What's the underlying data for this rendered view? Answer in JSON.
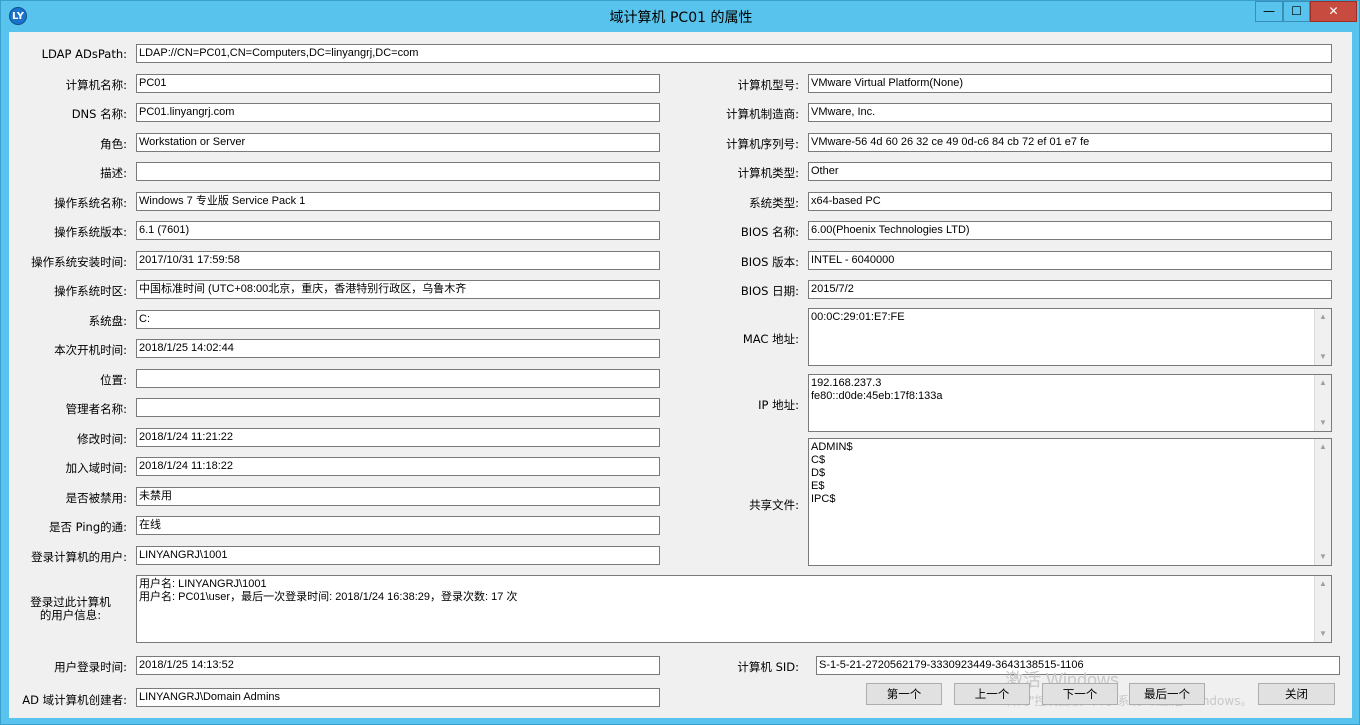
{
  "window": {
    "title": "域计算机 PC01 的属性",
    "icon_text": "LY",
    "minimize": "—",
    "maximize": "☐",
    "close": "✕"
  },
  "ldap": {
    "label": "LDAP ADsPath:",
    "value": "LDAP://CN=PC01,CN=Computers,DC=linyangrj,DC=com"
  },
  "left_fields": [
    {
      "label": "计算机名称:",
      "value": "PC01"
    },
    {
      "label": "DNS 名称:",
      "value": "PC01.linyangrj.com"
    },
    {
      "label": "角色:",
      "value": "Workstation or Server"
    },
    {
      "label": "描述:",
      "value": ""
    },
    {
      "label": "操作系统名称:",
      "value": "Windows 7 专业版 Service Pack 1"
    },
    {
      "label": "操作系统版本:",
      "value": "6.1 (7601)"
    },
    {
      "label": "操作系统安装时间:",
      "value": "2017/10/31 17:59:58"
    },
    {
      "label": "操作系统时区:",
      "value": "中国标准时间 (UTC+08:00北京，重庆，香港特别行政区，乌鲁木齐"
    },
    {
      "label": "系统盘:",
      "value": "C:"
    },
    {
      "label": "本次开机时间:",
      "value": "2018/1/25 14:02:44"
    },
    {
      "label": "位置:",
      "value": ""
    },
    {
      "label": "管理者名称:",
      "value": ""
    },
    {
      "label": "修改时间:",
      "value": "2018/1/24 11:21:22"
    },
    {
      "label": "加入域时间:",
      "value": "2018/1/24 11:18:22"
    },
    {
      "label": "是否被禁用:",
      "value": "未禁用"
    },
    {
      "label": "是否 Ping的通:",
      "value": "在线"
    },
    {
      "label": "登录计算机的用户:",
      "value": "LINYANGRJ\\1001"
    }
  ],
  "right_fields": [
    {
      "label": "计算机型号:",
      "value": "VMware Virtual Platform(None)"
    },
    {
      "label": "计算机制造商:",
      "value": "VMware, Inc."
    },
    {
      "label": "计算机序列号:",
      "value": "VMware-56 4d 60 26 32 ce 49 0d-c6 84 cb 72 ef 01 e7 fe"
    },
    {
      "label": "计算机类型:",
      "value": "Other"
    },
    {
      "label": "系统类型:",
      "value": "x64-based PC"
    },
    {
      "label": "BIOS 名称:",
      "value": "6.00(Phoenix Technologies LTD)"
    },
    {
      "label": "BIOS 版本:",
      "value": "INTEL  - 6040000"
    },
    {
      "label": "BIOS 日期:",
      "value": "2015/7/2"
    }
  ],
  "mac": {
    "label": "MAC 地址:",
    "lines": [
      "00:0C:29:01:E7:FE"
    ]
  },
  "ip": {
    "label": "IP 地址:",
    "lines": [
      "192.168.237.3",
      "fe80::d0de:45eb:17f8:133a"
    ]
  },
  "shares": {
    "label": "共享文件:",
    "lines": [
      "ADMIN$",
      "C$",
      "D$",
      "E$",
      "IPC$"
    ]
  },
  "login_info": {
    "label_line1": "登录过此计算机",
    "label_line2": "的用户信息:",
    "lines": [
      "用户名: LINYANGRJ\\1001",
      "用户名: PC01\\user，最后一次登录时间: 2018/1/24 16:38:29，登录次数: 17 次"
    ]
  },
  "user_login_time": {
    "label": "用户登录时间:",
    "value": "2018/1/25 14:13:52"
  },
  "creator": {
    "label": "AD 域计算机创建者:",
    "value": "LINYANGRJ\\Domain Admins"
  },
  "sid": {
    "label": "计算机 SID:",
    "value": "S-1-5-21-2720562179-3330923449-3643138515-1106"
  },
  "buttons": {
    "first": "第一个",
    "prev": "上一个",
    "next": "下一个",
    "last": "最后一个",
    "close": "关闭"
  },
  "watermark": {
    "line1": "激活 Windows",
    "line2": "转到\"控制面板\"中的\"系统\"以激活 Windows。"
  }
}
